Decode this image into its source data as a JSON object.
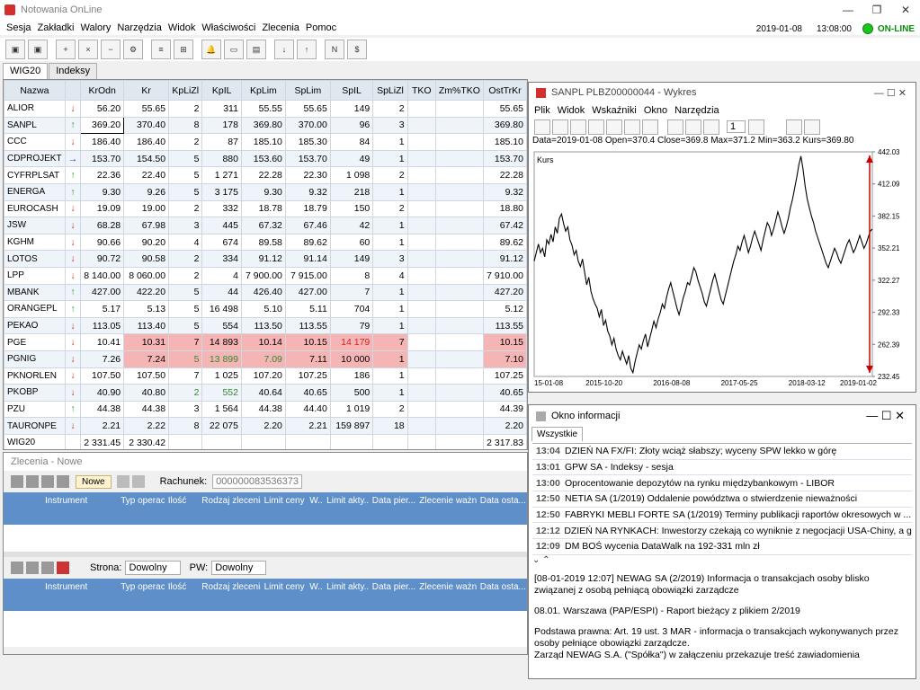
{
  "app": {
    "title": "Notowania OnLine",
    "date": "2019-01-08",
    "time": "13:08:00",
    "status": "ON-LINE"
  },
  "menu": [
    "Sesja",
    "Zakładki",
    "Walory",
    "Narzędzia",
    "Widok",
    "Właściwości",
    "Zlecenia",
    "Pomoc"
  ],
  "tabs": [
    "WIG20",
    "Indeksy"
  ],
  "quotes": {
    "headers": [
      "Nazwa",
      "",
      "KrOdn",
      "Kr",
      "KpLiZl",
      "KpIL",
      "KpLim",
      "SpLim",
      "SpIL",
      "SpLiZl",
      "TKO",
      "Zm%TKO",
      "OstTrKr"
    ],
    "rows": [
      [
        "ALIOR",
        "down",
        "56.20",
        "55.65",
        "2",
        "311",
        "55.55",
        "55.65",
        "149",
        "2",
        "",
        "",
        "55.65"
      ],
      [
        "SANPL",
        "up",
        "369.20",
        "370.40",
        "8",
        "178",
        "369.80",
        "370.00",
        "96",
        "3",
        "",
        "",
        "369.80"
      ],
      [
        "CCC",
        "down",
        "186.40",
        "186.40",
        "2",
        "87",
        "185.10",
        "185.30",
        "84",
        "1",
        "",
        "",
        "185.10"
      ],
      [
        "CDPROJEKT",
        "right",
        "153.70",
        "154.50",
        "5",
        "880",
        "153.60",
        "153.70",
        "49",
        "1",
        "",
        "",
        "153.70"
      ],
      [
        "CYFRPLSAT",
        "up",
        "22.36",
        "22.40",
        "5",
        "1 271",
        "22.28",
        "22.30",
        "1 098",
        "2",
        "",
        "",
        "22.28"
      ],
      [
        "ENERGA",
        "up",
        "9.30",
        "9.26",
        "5",
        "3 175",
        "9.30",
        "9.32",
        "218",
        "1",
        "",
        "",
        "9.32"
      ],
      [
        "EUROCASH",
        "down",
        "19.09",
        "19.00",
        "2",
        "332",
        "18.78",
        "18.79",
        "150",
        "2",
        "",
        "",
        "18.80"
      ],
      [
        "JSW",
        "down",
        "68.28",
        "67.98",
        "3",
        "445",
        "67.32",
        "67.46",
        "42",
        "1",
        "",
        "",
        "67.42"
      ],
      [
        "KGHM",
        "down",
        "90.66",
        "90.20",
        "4",
        "674",
        "89.58",
        "89.62",
        "60",
        "1",
        "",
        "",
        "89.62"
      ],
      [
        "LOTOS",
        "down",
        "90.72",
        "90.58",
        "2",
        "334",
        "91.12",
        "91.14",
        "149",
        "3",
        "",
        "",
        "91.12"
      ],
      [
        "LPP",
        "down",
        "8 140.00",
        "8 060.00",
        "2",
        "4",
        "7 900.00",
        "7 915.00",
        "8",
        "4",
        "",
        "",
        "7 910.00"
      ],
      [
        "MBANK",
        "up",
        "427.00",
        "422.20",
        "5",
        "44",
        "426.40",
        "427.00",
        "7",
        "1",
        "",
        "",
        "427.20"
      ],
      [
        "ORANGEPL",
        "up",
        "5.17",
        "5.13",
        "5",
        "16 498",
        "5.10",
        "5.11",
        "704",
        "1",
        "",
        "",
        "5.12"
      ],
      [
        "PEKAO",
        "down",
        "113.05",
        "113.40",
        "5",
        "554",
        "113.50",
        "113.55",
        "79",
        "1",
        "",
        "",
        "113.55"
      ],
      [
        "PGE",
        "down",
        "10.41",
        "10.31",
        "7",
        "14 893",
        "10.14",
        "10.15",
        "14 179",
        "7",
        "",
        "",
        "10.15"
      ],
      [
        "PGNIG",
        "down",
        "7.26",
        "7.24",
        "5",
        "13 899",
        "7.09",
        "7.11",
        "10 000",
        "1",
        "",
        "",
        "7.10"
      ],
      [
        "PKNORLEN",
        "down",
        "107.50",
        "107.50",
        "7",
        "1 025",
        "107.20",
        "107.25",
        "186",
        "1",
        "",
        "",
        "107.25"
      ],
      [
        "PKOBP",
        "down",
        "40.90",
        "40.80",
        "2",
        "552",
        "40.64",
        "40.65",
        "500",
        "1",
        "",
        "",
        "40.65"
      ],
      [
        "PZU",
        "up",
        "44.38",
        "44.38",
        "3",
        "1 564",
        "44.38",
        "44.40",
        "1 019",
        "2",
        "",
        "",
        "44.39"
      ],
      [
        "TAURONPE",
        "down",
        "2.21",
        "2.22",
        "8",
        "22 075",
        "2.20",
        "2.21",
        "159 897",
        "18",
        "",
        "",
        "2.20"
      ],
      [
        "WIG20",
        "",
        "2 331.45",
        "2 330.42",
        "",
        "",
        "",
        "",
        "",
        "",
        "",
        "",
        "2 317.83"
      ]
    ]
  },
  "orders": {
    "title": "Zlecenia - Nowe",
    "nowe_label": "Nowe",
    "rachunek_label": "Rachunek:",
    "rachunek_value": "000000083536373",
    "columns": [
      "Instrument",
      "Typ operacji",
      "Ilość",
      "Rodzaj zlecenia",
      "Limit ceny",
      "W...",
      "Limit akty...",
      "Data pier...",
      "Zlecenie ważne",
      "Data osta..."
    ],
    "strona_label": "Strona:",
    "strona_value": "Dowolny",
    "pw_label": "PW:",
    "pw_value": "Dowolny",
    "columns2": [
      "Instrument",
      "Typ operacji",
      "Ilość",
      "Rodzaj zlecenia",
      "Limit ceny",
      "W...",
      "Limit akty...",
      "Data pier...",
      "Zlecenie ważne",
      "Data osta..."
    ]
  },
  "chart_window": {
    "title": "SANPL PLBZ00000044 - Wykres",
    "menu": [
      "Plik",
      "Widok",
      "Wskaźniki",
      "Okno",
      "Narzędzia"
    ],
    "period": "1",
    "info": "Data=2019-01-08 Open=370.4 Close=369.8 Max=371.2 Min=363.2 Kurs=369.80"
  },
  "chart_data": {
    "type": "line",
    "series_label": "Kurs",
    "x_labels": [
      "15-01-08",
      "2015-10-20",
      "2016-08-08",
      "2017-05-25",
      "2018-03-12",
      "2019-01-02"
    ],
    "y_ticks": [
      232.45,
      262.39,
      292.33,
      322.27,
      352.21,
      382.15,
      412.09,
      442.03
    ],
    "ylim": [
      232.45,
      442.03
    ],
    "values": [
      340,
      348,
      356,
      348,
      352,
      344,
      360,
      356,
      365,
      358,
      372,
      366,
      380,
      384,
      375,
      368,
      372,
      360,
      355,
      346,
      350,
      340,
      335,
      342,
      330,
      318,
      325,
      312,
      305,
      300,
      296,
      288,
      295,
      280,
      285,
      275,
      270,
      262,
      268,
      258,
      252,
      248,
      256,
      250,
      244,
      252,
      240,
      236,
      246,
      254,
      262,
      258,
      266,
      272,
      260,
      268,
      276,
      284,
      278,
      286,
      292,
      300,
      296,
      306,
      314,
      320,
      312,
      304,
      296,
      290,
      298,
      306,
      312,
      320,
      318,
      326,
      334,
      330,
      322,
      316,
      310,
      302,
      298,
      306,
      314,
      322,
      328,
      320,
      312,
      304,
      300,
      308,
      316,
      324,
      332,
      340,
      346,
      354,
      350,
      358,
      364,
      356,
      348,
      354,
      362,
      368,
      362,
      356,
      350,
      360,
      368,
      376,
      372,
      364,
      370,
      378,
      386,
      380,
      372,
      366,
      372,
      380,
      390,
      398,
      408,
      418,
      430,
      438,
      426,
      410,
      398,
      390,
      382,
      376,
      368,
      362,
      356,
      350,
      344,
      338,
      334,
      340,
      346,
      352,
      348,
      342,
      338,
      344,
      350,
      356,
      360,
      354,
      348,
      352,
      358,
      364,
      358,
      352,
      356,
      362,
      368,
      370
    ]
  },
  "info_window": {
    "title": "Okno informacji",
    "tab": "Wszystkie",
    "news": [
      {
        "time": "13:04",
        "text": "DZIEŃ NA FX/FI: Złoty wciąż słabszy; wyceny SPW lekko w górę"
      },
      {
        "time": "13:01",
        "text": "GPW SA - Indeksy - sesja"
      },
      {
        "time": "13:00",
        "text": "Oprocentowanie depozytów na rynku międzybankowym - LIBOR"
      },
      {
        "time": "12:50",
        "text": "NETIA SA (1/2019) Oddalenie powództwa o stwierdzenie nieważności"
      },
      {
        "time": "12:50",
        "text": "FABRYKI MEBLI FORTE SA (1/2019) Terminy publikacji raportów okresowych w ..."
      },
      {
        "time": "12:12",
        "text": "DZIEŃ NA RYNKACH: Inwestorzy czekają co wyniknie z negocjacji USA-Chiny, a g..."
      },
      {
        "time": "12:09",
        "text": "DM BOŚ wycenia DataWalk na 192-331 mln zł"
      }
    ],
    "detail": [
      "[08-01-2019 12:07] NEWAG SA (2/2019) Informacja o transakcjach osoby blisko związanej z osobą pełniącą obowiązki zarządcze",
      "08.01. Warszawa (PAP/ESPI) - Raport bieżący z plikiem 2/2019",
      "Podstawa prawna: Art. 19 ust. 3 MAR - informacja o transakcjach wykonywanych przez osoby pełniące obowiązki zarządcze.",
      "Zarząd NEWAG S.A. (\"Spółka\") w załączeniu przekazuje treść zawiadomienia"
    ]
  }
}
